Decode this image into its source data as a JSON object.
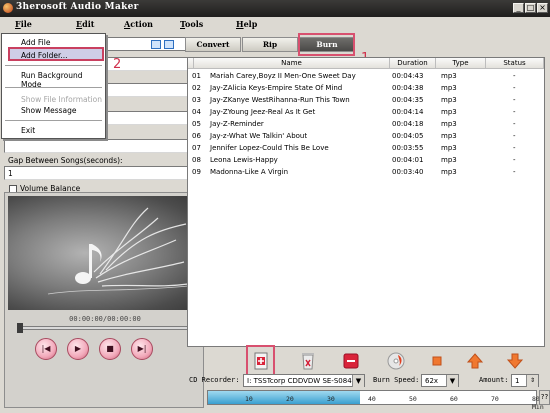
{
  "window": {
    "title": "3herosoft Audio Maker"
  },
  "menubar": [
    "File",
    "Edit",
    "Action",
    "Tools",
    "Help"
  ],
  "context_menu": {
    "items": [
      {
        "label": "Add File",
        "disabled": false
      },
      {
        "label": "Add Folder...",
        "disabled": false
      },
      {
        "label": "Run Background Mode",
        "disabled": false
      },
      {
        "label": "Show File Information",
        "disabled": true
      },
      {
        "label": "Show Message",
        "disabled": false
      },
      {
        "label": "Exit",
        "disabled": false
      }
    ]
  },
  "annotations": {
    "tab_marker": "1",
    "menu_marker": "2"
  },
  "settings": {
    "gap_label": "Gap Between Songs(seconds):",
    "gap_value": "1",
    "volume_balance_label": "Volume Balance",
    "volume_balance_checked": false
  },
  "player": {
    "time": "00:00:00/00:00:00"
  },
  "tabs": [
    {
      "label": "Convert",
      "active": false
    },
    {
      "label": "Rip",
      "active": false
    },
    {
      "label": "Burn",
      "active": true
    }
  ],
  "table": {
    "columns": [
      "",
      "Name",
      "Duration",
      "Type",
      "Status"
    ],
    "rows": [
      {
        "num": "01",
        "name": "Mariah Carey,Boyz II Men-One Sweet Day",
        "duration": "00:04:43",
        "type": "mp3",
        "status": "-"
      },
      {
        "num": "02",
        "name": "Jay-ZAlicia Keys-Empire State Of Mind",
        "duration": "00:04:38",
        "type": "mp3",
        "status": "-"
      },
      {
        "num": "03",
        "name": "Jay-ZKanye WestRihanna-Run This Town",
        "duration": "00:04:35",
        "type": "mp3",
        "status": "-"
      },
      {
        "num": "04",
        "name": "Jay-ZYoung Jeez-Real As It Get",
        "duration": "00:04:14",
        "type": "mp3",
        "status": "-"
      },
      {
        "num": "05",
        "name": "Jay-Z-Reminder",
        "duration": "00:04:18",
        "type": "mp3",
        "status": "-"
      },
      {
        "num": "06",
        "name": "Jay-z-What We Talkin' About",
        "duration": "00:04:05",
        "type": "mp3",
        "status": "-"
      },
      {
        "num": "07",
        "name": "Jennifer Lopez-Could This Be Love",
        "duration": "00:03:55",
        "type": "mp3",
        "status": "-"
      },
      {
        "num": "08",
        "name": "Leona Lewis-Happy",
        "duration": "00:04:01",
        "type": "mp3",
        "status": "-"
      },
      {
        "num": "09",
        "name": "Madonna-Like A Virgin",
        "duration": "00:03:40",
        "type": "mp3",
        "status": "-"
      }
    ]
  },
  "toolbar": [
    "add-file-icon",
    "clear-list-icon",
    "remove-icon",
    "burn-disc-icon",
    "stop-icon",
    "move-up-icon",
    "move-down-icon"
  ],
  "burn": {
    "recorder_label": "CD Recorder:",
    "recorder_value": "I: TSSTcorp CDDVDW SE-S084B",
    "speed_label": "Burn Speed:",
    "speed_value": "62x",
    "amount_label": "Amount:",
    "amount_value": "1"
  },
  "capacity": {
    "ticks": [
      "10",
      "20",
      "30",
      "40",
      "50",
      "60",
      "70",
      "80 Min"
    ],
    "used_minutes": 37,
    "help": "??"
  },
  "colors": {
    "annotation": "#d8506f",
    "capacity_fill": "#3aa0d0"
  }
}
